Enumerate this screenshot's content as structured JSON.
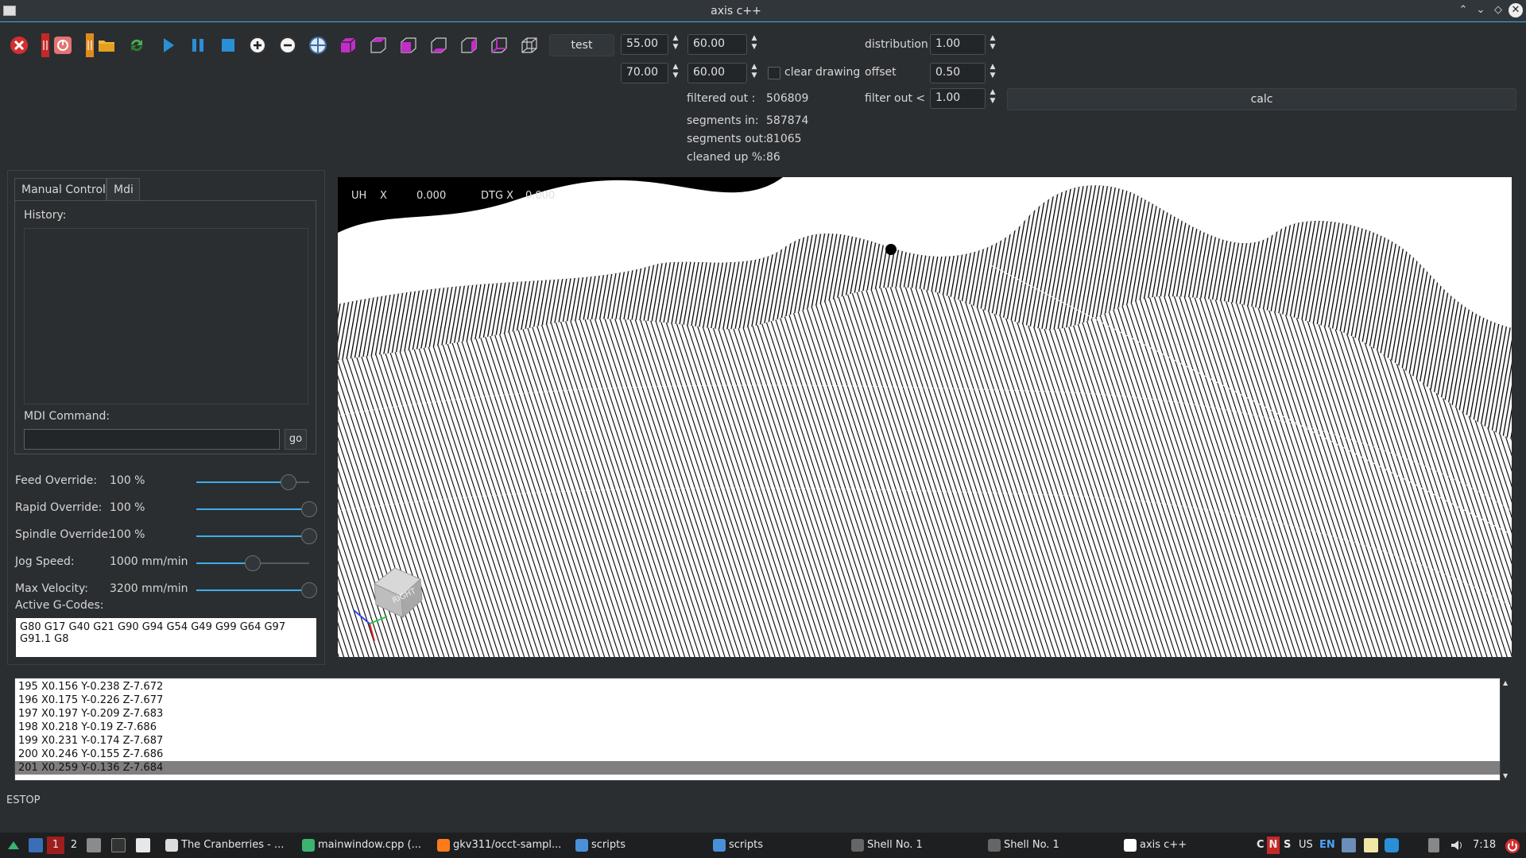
{
  "window": {
    "title": "axis c++"
  },
  "toolbar": {
    "test_label": "test",
    "field_a1": "55.00",
    "field_a2": "60.00",
    "field_b1": "70.00",
    "field_b2": "60.00",
    "clear_drawing_label": "clear drawing",
    "distribution_label": "distribution",
    "distribution_value": "1.00",
    "offset_label": "offset",
    "offset_value": "0.50",
    "filter_out_label": "filter out <",
    "filter_out_value": "1.00",
    "calc_label": "calc"
  },
  "stats": [
    {
      "label": "filtered out :",
      "value": "506809"
    },
    {
      "label": "segments in:",
      "value": "587874"
    },
    {
      "label": "segments out:",
      "value": "81065"
    },
    {
      "label": "cleaned up %:",
      "value": "86"
    }
  ],
  "left": {
    "tabs": [
      "Manual Control",
      "Mdi"
    ],
    "history_label": "History:",
    "mdi_label": "MDI Command:",
    "go_label": "go",
    "overrides": [
      {
        "label": "Feed Override:",
        "value": "100 %",
        "level": 0.82
      },
      {
        "label": "Rapid Override:",
        "value": "100 %",
        "level": 1.0
      },
      {
        "label": "Spindle Override:",
        "value": "100 %",
        "level": 1.0
      },
      {
        "label": "Jog Speed:",
        "value": "1000 mm/min",
        "level": 0.5
      },
      {
        "label": "Max Velocity:",
        "value": "3200 mm/min",
        "level": 1.0
      }
    ],
    "active_gcodes_label": "Active G-Codes:",
    "active_gcodes_line1": "G80 G17 G40 G21 G90 G94 G54 G49 G99 G64 G97",
    "active_gcodes_line2": "G91.1 G8"
  },
  "viewport": {
    "dro_prefix": "UH",
    "dro_axis": "X",
    "dro_value": "0.000",
    "dtg_label": "DTG X",
    "dtg_value": "0.000",
    "cube_label": "RIGHT"
  },
  "gcode_lines": [
    {
      "num": "195",
      "code": "X0.156 Y-0.238 Z-7.672"
    },
    {
      "num": "196",
      "code": "X0.175 Y-0.226 Z-7.677"
    },
    {
      "num": "197",
      "code": "X0.197 Y-0.209 Z-7.683"
    },
    {
      "num": "198",
      "code": "X0.218 Y-0.19 Z-7.686"
    },
    {
      "num": "199",
      "code": "X0.231 Y-0.174 Z-7.687"
    },
    {
      "num": "200",
      "code": "X0.246 Y-0.155 Z-7.686"
    },
    {
      "num": "201",
      "code": "X0.259 Y-0.136 Z-7.684"
    }
  ],
  "status": "ESTOP",
  "taskbar": {
    "desktop_1": "1",
    "desktop_2": "2",
    "items": [
      "The Cranberries - ...",
      "mainwindow.cpp (...",
      "gkv311/occt-sampl...",
      "scripts",
      "scripts",
      "Shell No. 1",
      "Shell No. 1",
      "axis c++"
    ],
    "tray_c": "C",
    "tray_n": "N",
    "tray_s": "S",
    "tray_layout": "US",
    "tray_lang": "EN",
    "clock": "7:18"
  }
}
